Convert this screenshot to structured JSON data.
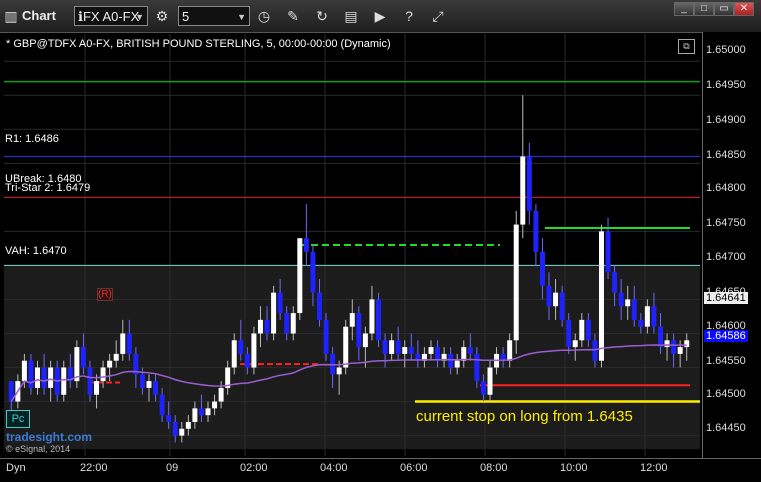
{
  "app": {
    "title": "Chart",
    "symbol": "ℹFX A0-FX",
    "interval": "5"
  },
  "header": {
    "description": "* GBP@TDFX A0-FX, BRITISH POUND STERLING, 5, 00:00-00:00 (Dynamic)"
  },
  "levels": {
    "r1": "R1: 1.6486",
    "ubreak": "UBreak: 1.6480",
    "tristar": "Tri-Star 2: 1.6479",
    "vah": "VAH: 1.6470"
  },
  "annotations": {
    "stop_note": "current stop on long from 1.6435",
    "branding": "tradesight.com",
    "copyright": "© eSignal, 2014",
    "pc_badge": "Pc",
    "dyn": "Dyn",
    "r_marker": "(R)"
  },
  "price_axis": {
    "labels": [
      "1.65000",
      "1.64950",
      "1.64900",
      "1.64850",
      "1.64800",
      "1.64750",
      "1.64700",
      "1.64650",
      "1.64600",
      "1.64550",
      "1.64500",
      "1.64450"
    ],
    "current_price": "1.64586",
    "vwap_price": "1.64641"
  },
  "time_axis": {
    "labels": [
      "22:00",
      "09",
      "02:00",
      "04:00",
      "06:00",
      "08:00",
      "10:00",
      "12:00"
    ]
  },
  "colors": {
    "up": "#ffffff",
    "down": "#1e22ff",
    "vwap": "#9a5fcf",
    "r1_line": "#1d33c9",
    "ubreak_line": "#b62020",
    "vah_line": "#7fd3d3",
    "top_line": "#14a014",
    "stop_line": "#ffee00",
    "green_line": "#22dd22",
    "red_line": "#ff2020"
  },
  "chart_data": {
    "type": "candlestick",
    "title": "GBP@TDFX A0-FX, BRITISH POUND STERLING, 5",
    "ylim": [
      1.6442,
      1.6504
    ],
    "current_price": 1.64586,
    "vwap_last": 1.64641,
    "horizontal_levels": [
      {
        "name": "R1",
        "value": 1.6486
      },
      {
        "name": "UBreak",
        "value": 1.648
      },
      {
        "name": "Tri-Star 2",
        "value": 1.6479
      },
      {
        "name": "VAH",
        "value": 1.647
      },
      {
        "name": "current stop",
        "value": 1.645
      }
    ],
    "candles": [
      [
        1.6453,
        1.6453,
        1.6448,
        1.645
      ],
      [
        1.645,
        1.6454,
        1.6449,
        1.6453
      ],
      [
        1.6453,
        1.6457,
        1.6452,
        1.6456
      ],
      [
        1.6456,
        1.6457,
        1.6451,
        1.6452
      ],
      [
        1.6452,
        1.6456,
        1.6451,
        1.6455
      ],
      [
        1.6455,
        1.6457,
        1.6451,
        1.6452
      ],
      [
        1.6452,
        1.6456,
        1.645,
        1.6455
      ],
      [
        1.6455,
        1.6456,
        1.645,
        1.6451
      ],
      [
        1.6451,
        1.6456,
        1.645,
        1.6455
      ],
      [
        1.6455,
        1.6457,
        1.6452,
        1.6453
      ],
      [
        1.6453,
        1.6459,
        1.6452,
        1.6458
      ],
      [
        1.6458,
        1.646,
        1.6454,
        1.6455
      ],
      [
        1.6455,
        1.6456,
        1.645,
        1.6451
      ],
      [
        1.6451,
        1.6454,
        1.6449,
        1.6453
      ],
      [
        1.6453,
        1.6456,
        1.6452,
        1.6455
      ],
      [
        1.6455,
        1.6457,
        1.6453,
        1.6456
      ],
      [
        1.6456,
        1.6459,
        1.6455,
        1.6457
      ],
      [
        1.6457,
        1.6462,
        1.6456,
        1.646
      ],
      [
        1.646,
        1.6462,
        1.6456,
        1.6457
      ],
      [
        1.6457,
        1.6458,
        1.6452,
        1.6454
      ],
      [
        1.6454,
        1.6455,
        1.6451,
        1.6452
      ],
      [
        1.6452,
        1.6454,
        1.645,
        1.6453
      ],
      [
        1.6453,
        1.6454,
        1.645,
        1.6451
      ],
      [
        1.6451,
        1.6452,
        1.6447,
        1.6448
      ],
      [
        1.6448,
        1.645,
        1.6446,
        1.6447
      ],
      [
        1.6447,
        1.6448,
        1.6444,
        1.6445
      ],
      [
        1.6445,
        1.6447,
        1.6444,
        1.6446
      ],
      [
        1.6446,
        1.6448,
        1.6445,
        1.6447
      ],
      [
        1.6447,
        1.645,
        1.6446,
        1.6449
      ],
      [
        1.6449,
        1.6451,
        1.6447,
        1.6448
      ],
      [
        1.6448,
        1.645,
        1.6447,
        1.6449
      ],
      [
        1.6449,
        1.6451,
        1.6448,
        1.645
      ],
      [
        1.645,
        1.6453,
        1.6449,
        1.6452
      ],
      [
        1.6452,
        1.6456,
        1.6451,
        1.6455
      ],
      [
        1.6455,
        1.646,
        1.6454,
        1.6459
      ],
      [
        1.6459,
        1.6462,
        1.6456,
        1.6457
      ],
      [
        1.6457,
        1.6458,
        1.6454,
        1.6455
      ],
      [
        1.6455,
        1.6461,
        1.6454,
        1.646
      ],
      [
        1.646,
        1.6464,
        1.6458,
        1.6462
      ],
      [
        1.6462,
        1.6464,
        1.6459,
        1.646
      ],
      [
        1.646,
        1.6467,
        1.6459,
        1.6466
      ],
      [
        1.6466,
        1.6468,
        1.6462,
        1.6463
      ],
      [
        1.6463,
        1.6464,
        1.6459,
        1.646
      ],
      [
        1.646,
        1.6464,
        1.6459,
        1.6463
      ],
      [
        1.6463,
        1.647,
        1.6462,
        1.6474
      ],
      [
        1.6474,
        1.6479,
        1.647,
        1.6472
      ],
      [
        1.6472,
        1.6473,
        1.6464,
        1.6466
      ],
      [
        1.6466,
        1.6468,
        1.6461,
        1.6462
      ],
      [
        1.6462,
        1.6463,
        1.6456,
        1.6457
      ],
      [
        1.6457,
        1.6458,
        1.6452,
        1.6454
      ],
      [
        1.6454,
        1.6456,
        1.6451,
        1.6455
      ],
      [
        1.6455,
        1.6462,
        1.6454,
        1.6461
      ],
      [
        1.6461,
        1.6465,
        1.6459,
        1.6463
      ],
      [
        1.6463,
        1.6464,
        1.6456,
        1.6458
      ],
      [
        1.6458,
        1.6461,
        1.6455,
        1.646
      ],
      [
        1.646,
        1.6467,
        1.6459,
        1.6465
      ],
      [
        1.6465,
        1.6466,
        1.6458,
        1.6459
      ],
      [
        1.6459,
        1.646,
        1.6455,
        1.6457
      ],
      [
        1.6457,
        1.646,
        1.6456,
        1.6459
      ],
      [
        1.6459,
        1.6461,
        1.6456,
        1.6457
      ],
      [
        1.6457,
        1.6459,
        1.6455,
        1.6458
      ],
      [
        1.6458,
        1.646,
        1.6456,
        1.6457
      ],
      [
        1.6457,
        1.6459,
        1.6455,
        1.6456
      ],
      [
        1.6456,
        1.6458,
        1.6455,
        1.6457
      ],
      [
        1.6457,
        1.6459,
        1.6456,
        1.6458
      ],
      [
        1.6458,
        1.6459,
        1.6455,
        1.6456
      ],
      [
        1.6456,
        1.6458,
        1.6455,
        1.6457
      ],
      [
        1.6457,
        1.6458,
        1.6454,
        1.6455
      ],
      [
        1.6455,
        1.6457,
        1.6454,
        1.6456
      ],
      [
        1.6456,
        1.6459,
        1.6455,
        1.6458
      ],
      [
        1.6458,
        1.646,
        1.6456,
        1.6457
      ],
      [
        1.6457,
        1.6458,
        1.6452,
        1.6453
      ],
      [
        1.6453,
        1.6454,
        1.645,
        1.6451
      ],
      [
        1.6451,
        1.6456,
        1.645,
        1.6455
      ],
      [
        1.6455,
        1.6458,
        1.6454,
        1.6457
      ],
      [
        1.6457,
        1.6458,
        1.6455,
        1.6456
      ],
      [
        1.6456,
        1.646,
        1.6455,
        1.6459
      ],
      [
        1.6459,
        1.6478,
        1.6457,
        1.6476
      ],
      [
        1.6476,
        1.6495,
        1.6474,
        1.6486
      ],
      [
        1.6486,
        1.6488,
        1.6476,
        1.6478
      ],
      [
        1.6478,
        1.6479,
        1.647,
        1.6472
      ],
      [
        1.6472,
        1.6474,
        1.6465,
        1.6467
      ],
      [
        1.6467,
        1.6469,
        1.6462,
        1.6464
      ],
      [
        1.6464,
        1.6468,
        1.6462,
        1.6466
      ],
      [
        1.6466,
        1.6467,
        1.6461,
        1.6462
      ],
      [
        1.6462,
        1.6463,
        1.6457,
        1.6458
      ],
      [
        1.6458,
        1.646,
        1.6456,
        1.6459
      ],
      [
        1.6459,
        1.6463,
        1.6458,
        1.6462
      ],
      [
        1.6462,
        1.6463,
        1.6458,
        1.6459
      ],
      [
        1.6459,
        1.646,
        1.6455,
        1.6456
      ],
      [
        1.6456,
        1.6476,
        1.6455,
        1.6475
      ],
      [
        1.6475,
        1.6477,
        1.6468,
        1.6469
      ],
      [
        1.6469,
        1.647,
        1.6464,
        1.6466
      ],
      [
        1.6466,
        1.6468,
        1.6462,
        1.6464
      ],
      [
        1.6464,
        1.6467,
        1.6462,
        1.6465
      ],
      [
        1.6465,
        1.6467,
        1.6461,
        1.6462
      ],
      [
        1.6462,
        1.6463,
        1.646,
        1.6461
      ],
      [
        1.6461,
        1.6465,
        1.646,
        1.6464
      ],
      [
        1.6464,
        1.6466,
        1.646,
        1.6461
      ],
      [
        1.6461,
        1.6463,
        1.6457,
        1.6458
      ],
      [
        1.6458,
        1.646,
        1.6456,
        1.6459
      ],
      [
        1.6459,
        1.646,
        1.6455,
        1.6457
      ],
      [
        1.6457,
        1.6459,
        1.6455,
        1.6458
      ],
      [
        1.6458,
        1.646,
        1.6456,
        1.6459
      ]
    ]
  }
}
